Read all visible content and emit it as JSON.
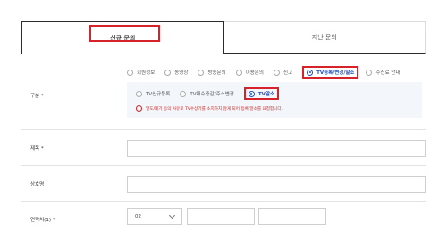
{
  "tabs": [
    {
      "label": "신규 문의"
    },
    {
      "label": "지난 문의"
    }
  ],
  "category": {
    "label": "구분 *",
    "options": [
      "회원정보",
      "동영상",
      "방송문의",
      "이용문의",
      "신고",
      "TV등록/변경/말소",
      "수신료 안내"
    ],
    "selected": "TV등록/변경/말소"
  },
  "sub_category": {
    "options": [
      "TV신규등록",
      "TV대수증감/주소변경",
      "TV말소"
    ],
    "selected": "TV말소",
    "warning_icon": "!",
    "warning": "멸도/폐기 등의 사유로 TV수상기를 소지하지 않게 되어 등록 말소를 요청합니다."
  },
  "title_field": {
    "label": "제목 *",
    "value": ""
  },
  "company_field": {
    "label": "상호명",
    "value": ""
  },
  "phone_field": {
    "label": "연락처(1) *",
    "area_code": "02",
    "middle": "",
    "last": ""
  },
  "colors": {
    "accent": "#1f4fbf",
    "highlight": "#d6222a",
    "warning": "#c62828"
  }
}
